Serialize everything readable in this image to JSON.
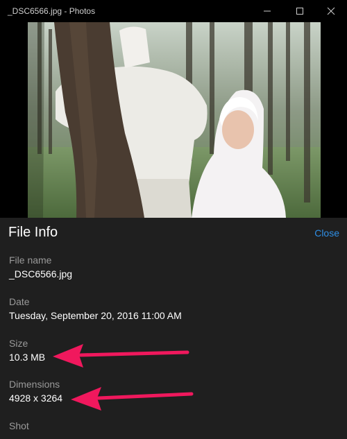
{
  "window": {
    "title": "_DSC6566.jpg - Photos",
    "controls": [
      "minimize-icon",
      "maximize-icon",
      "close-icon"
    ]
  },
  "photo": {
    "subject": "photo-image"
  },
  "panel": {
    "heading": "File Info",
    "close_label": "Close",
    "accent_color": "#2e8fe6",
    "fields": [
      {
        "label": "File name",
        "value": "_DSC6566.jpg"
      },
      {
        "label": "Date",
        "value": "Tuesday, September 20, 2016 11:00 AM"
      },
      {
        "label": "Size",
        "value": "10.3 MB"
      },
      {
        "label": "Dimensions",
        "value": "4928 x 3264"
      },
      {
        "label": "Shot",
        "value": ""
      }
    ]
  },
  "annotations": {
    "arrow_color": "#f0185d"
  }
}
